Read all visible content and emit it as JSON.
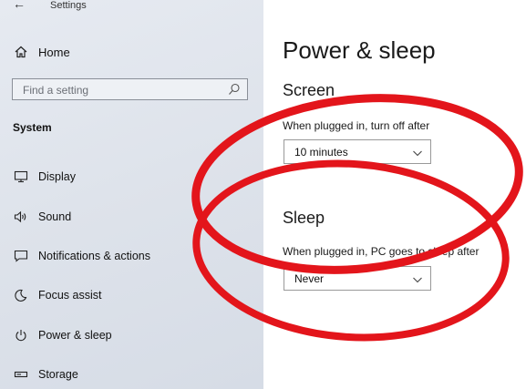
{
  "app": {
    "title": "Settings"
  },
  "sidebar": {
    "home_label": "Home",
    "search_placeholder": "Find a setting",
    "section_title": "System",
    "items": [
      {
        "label": "Display",
        "icon": "display-icon"
      },
      {
        "label": "Sound",
        "icon": "speaker-icon"
      },
      {
        "label": "Notifications & actions",
        "icon": "notification-icon"
      },
      {
        "label": "Focus assist",
        "icon": "moon-icon"
      },
      {
        "label": "Power & sleep",
        "icon": "power-icon"
      },
      {
        "label": "Storage",
        "icon": "storage-icon"
      }
    ]
  },
  "main": {
    "page_title": "Power & sleep",
    "screen": {
      "heading": "Screen",
      "label": "When plugged in, turn off after",
      "value": "10 minutes"
    },
    "sleep": {
      "heading": "Sleep",
      "label": "When plugged in, PC goes to sleep after",
      "value": "Never"
    }
  },
  "colors": {
    "annotation_red": "#e3151b"
  }
}
